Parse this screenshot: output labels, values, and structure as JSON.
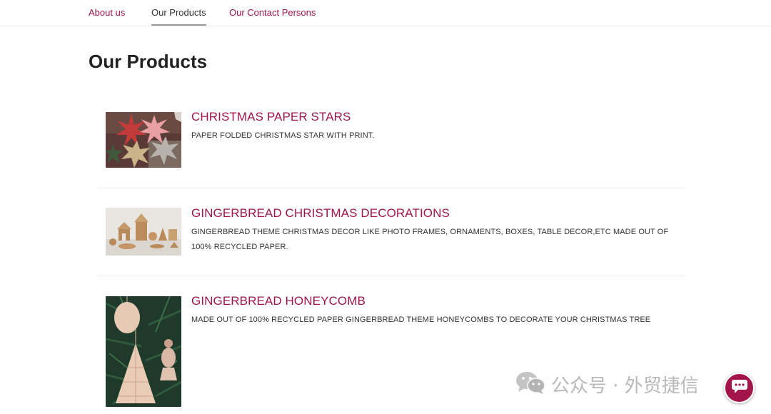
{
  "nav": {
    "items": [
      {
        "label": "About us",
        "active": false
      },
      {
        "label": "Our Products",
        "active": true
      },
      {
        "label": "Our Contact Persons",
        "active": false
      }
    ]
  },
  "page_title": "Our Products",
  "products": [
    {
      "title": "CHRISTMAS PAPER STARS",
      "description": "PAPER FOLDED CHRISTMAS STAR WITH PRINT.",
      "image_icon": "paper-stars-image"
    },
    {
      "title": "GINGERBREAD CHRISTMAS DECORATIONS",
      "description": "GINGERBREAD THEME CHRISTMAS DECOR LIKE PHOTO FRAMES, ORNAMENTS, BOXES, TABLE DECOR,ETC MADE OUT OF 100% RECYCLED PAPER.",
      "image_icon": "gingerbread-decorations-image"
    },
    {
      "title": "GINGERBREAD HONEYCOMB",
      "description": "MADE OUT OF 100% RECYCLED PAPER GINGERBREAD THEME HONEYCOMBS TO DECORATE YOUR CHRISTMAS TREE",
      "image_icon": "gingerbread-honeycomb-image"
    }
  ],
  "watermark": {
    "text": "公众号 · 外贸捷信",
    "icon": "wechat-icon"
  },
  "chat_button": {
    "icon": "chat-bubble-icon"
  },
  "colors": {
    "accent": "#a0154d",
    "text": "#333333",
    "divider": "#ececec",
    "chat_button": "#a3154a"
  }
}
